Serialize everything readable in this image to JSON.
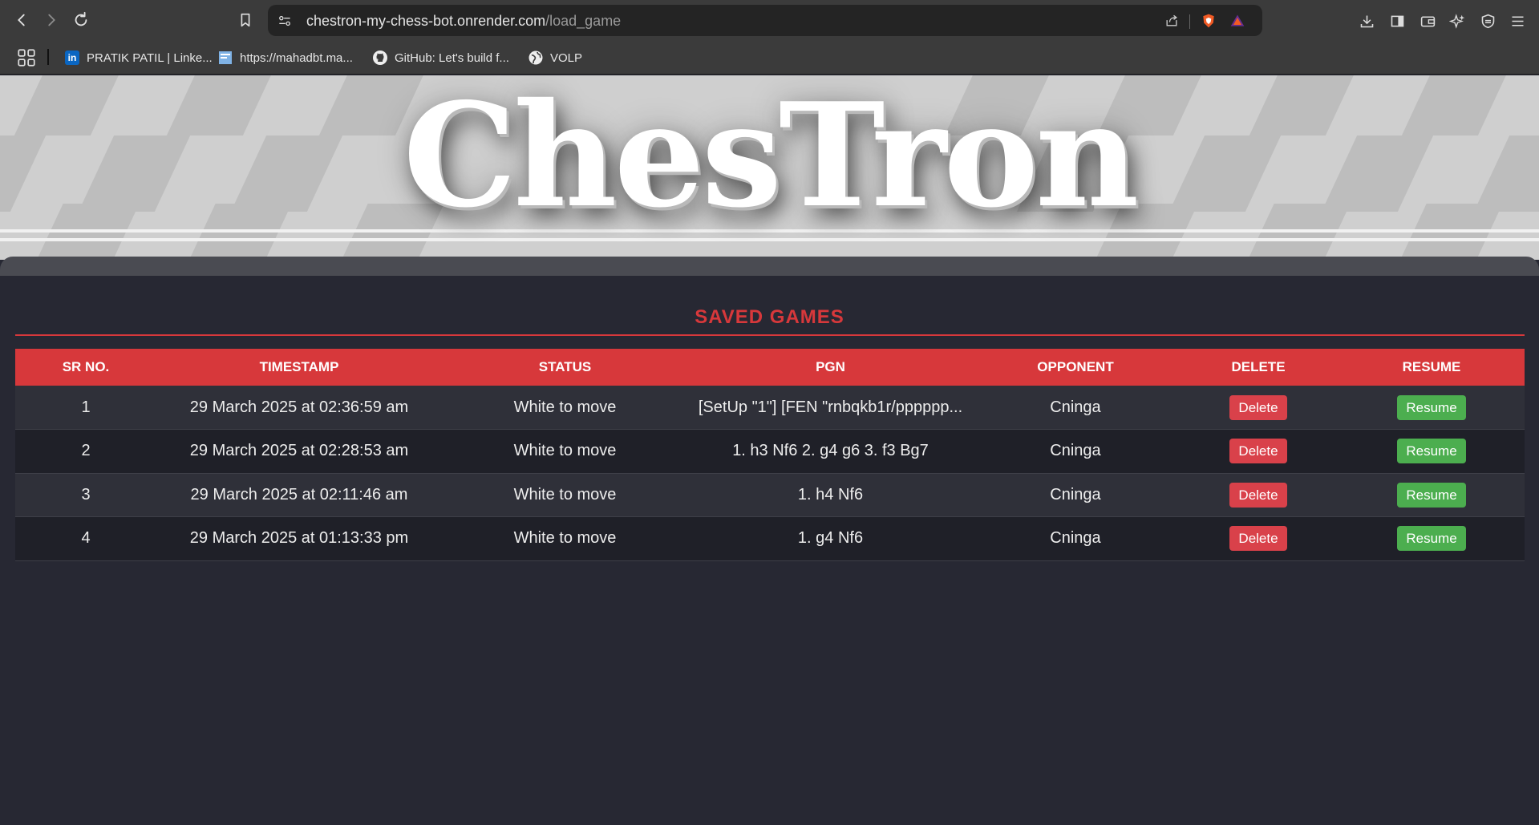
{
  "browser": {
    "url_host": "chestron-my-chess-bot.onrender.com",
    "url_path": "/load_game"
  },
  "bookmarks": [
    {
      "label": "PRATIK PATIL | Linke...",
      "icon": "linkedin-icon"
    },
    {
      "label": "https://mahadbt.ma...",
      "icon": "page-icon"
    },
    {
      "label": "GitHub: Let's build f...",
      "icon": "github-icon"
    },
    {
      "label": "VOLP",
      "icon": "globe-icon"
    }
  ],
  "logo": "ChesTron",
  "section_title": "SAVED GAMES",
  "colors": {
    "accent": "#d7383b",
    "delete": "#d9414a",
    "resume": "#4cae4f",
    "page_bg": "#272833"
  },
  "table": {
    "headers": [
      "SR NO.",
      "TIMESTAMP",
      "STATUS",
      "PGN",
      "OPPONENT",
      "DELETE",
      "RESUME"
    ],
    "rows": [
      {
        "sr": "1",
        "timestamp": "29 March 2025 at 02:36:59 am",
        "status": "White to move",
        "pgn": "[SetUp \"1\"] [FEN \"rnbqkb1r/pppppp...",
        "opponent": "Cninga",
        "delete": "Delete",
        "resume": "Resume"
      },
      {
        "sr": "2",
        "timestamp": "29 March 2025 at 02:28:53 am",
        "status": "White to move",
        "pgn": "1. h3 Nf6 2. g4 g6 3. f3 Bg7",
        "opponent": "Cninga",
        "delete": "Delete",
        "resume": "Resume"
      },
      {
        "sr": "3",
        "timestamp": "29 March 2025 at 02:11:46 am",
        "status": "White to move",
        "pgn": "1. h4 Nf6",
        "opponent": "Cninga",
        "delete": "Delete",
        "resume": "Resume"
      },
      {
        "sr": "4",
        "timestamp": "29 March 2025 at 01:13:33 pm",
        "status": "White to move",
        "pgn": "1. g4 Nf6",
        "opponent": "Cninga",
        "delete": "Delete",
        "resume": "Resume"
      }
    ]
  }
}
